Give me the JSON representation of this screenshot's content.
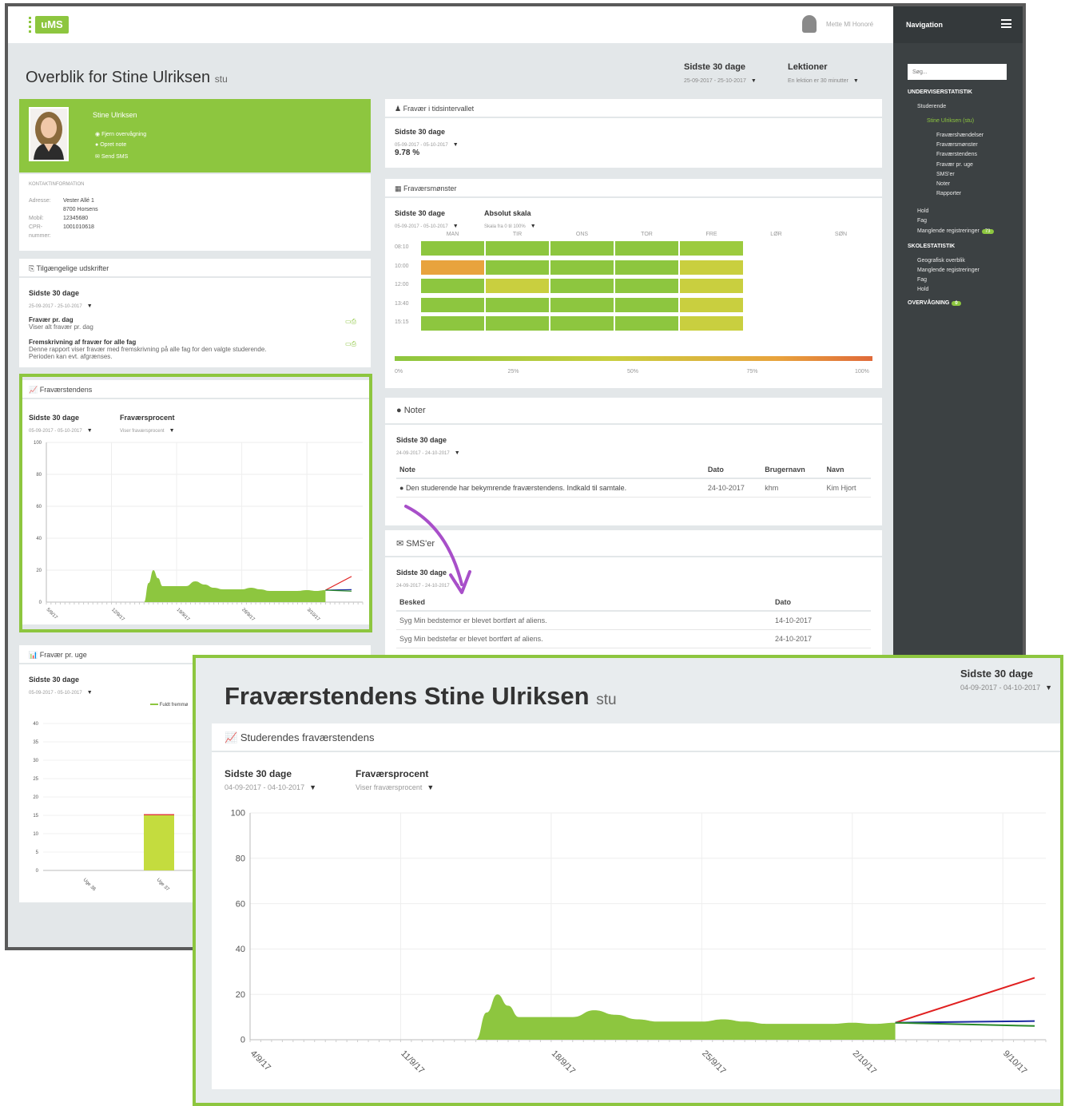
{
  "topbar": {
    "logo": "uMS",
    "user": "Mette Ml Honoré"
  },
  "sidebar": {
    "title": "Navigation",
    "search_placeholder": "Søg...",
    "items": [
      {
        "label": "UNDERVISERSTATISTIK",
        "kind": "section"
      },
      {
        "label": "Studerende",
        "kind": "item"
      },
      {
        "label": "Stine Ulriksen (stu)",
        "kind": "active"
      },
      {
        "label": "Fraværshændelser",
        "kind": "sub"
      },
      {
        "label": "Fraværsmønster",
        "kind": "sub"
      },
      {
        "label": "Fraværstendens",
        "kind": "sub"
      },
      {
        "label": "Fravær pr. uge",
        "kind": "sub"
      },
      {
        "label": "SMS'er",
        "kind": "sub"
      },
      {
        "label": "Noter",
        "kind": "sub"
      },
      {
        "label": "Rapporter",
        "kind": "sub"
      },
      {
        "label": "Hold",
        "kind": "item"
      },
      {
        "label": "Fag",
        "kind": "item"
      },
      {
        "label": "Manglende registreringer",
        "kind": "item",
        "badge": "73"
      },
      {
        "label": "SKOLESTATISTIK",
        "kind": "section"
      },
      {
        "label": "Geografisk overblik",
        "kind": "item"
      },
      {
        "label": "Manglende registreringer",
        "kind": "item"
      },
      {
        "label": "Fag",
        "kind": "item"
      },
      {
        "label": "Hold",
        "kind": "item"
      },
      {
        "label": "OVERVÅGNING",
        "kind": "section",
        "badge": "0"
      }
    ]
  },
  "page": {
    "title": "Overblik for Stine Ulriksen",
    "tag": "stu",
    "filter_period": {
      "label": "Sidste 30 dage",
      "range": "25-09-2017 - 25-10-2017"
    },
    "filter_lessons": {
      "label": "Lektioner",
      "sub": "En lektion er 30 minutter"
    }
  },
  "profile": {
    "name": "Stine Ulriksen",
    "links": [
      "Fjern overvågning",
      "Opret note",
      "Send SMS"
    ],
    "contact_title": "KONTAKTINFORMATION",
    "contact": [
      {
        "k": "Adresse:",
        "v": "Vester Allé 1"
      },
      {
        "k": "",
        "v": "8700 Horsens"
      },
      {
        "k": "Mobil:",
        "v": "12345680"
      },
      {
        "k": "CPR-",
        "v": "1001010618"
      },
      {
        "k": "nummer:",
        "v": ""
      }
    ]
  },
  "reports": {
    "title": "Tilgængelige udskrifter",
    "period": "Sidste 30 dage",
    "range": "25-09-2017 - 25-10-2017",
    "items": [
      {
        "title": "Fravær pr. dag",
        "desc": "Viser alt fravær pr. dag"
      },
      {
        "title": "Fremskrivning af fravær for alle fag",
        "desc": "Denne rapport viser fravær med fremskrivning på alle fag for den valgte studerende.",
        "desc2": "Perioden kan evt. afgrænses."
      }
    ]
  },
  "trend_small": {
    "title": "Fraværstendens",
    "period": "Sidste 30 dage",
    "range": "05-09-2017 - 05-10-2017",
    "metric": "Fraværsprocent",
    "metric_sub": "Viser fraværsprocent",
    "yticks": [
      "100",
      "80",
      "60",
      "40",
      "20",
      "0"
    ],
    "xticks": [
      "5/9/17",
      "12/9/17",
      "19/9/17",
      "26/9/17",
      "3/10/17"
    ]
  },
  "weekly": {
    "title": "Fravær pr. uge",
    "period": "Sidste 30 dage",
    "range": "05-09-2017 - 05-10-2017",
    "legend": "Fuldt fremmø",
    "yticks": [
      "40",
      "35",
      "30",
      "25",
      "20",
      "15",
      "10",
      "5",
      "0"
    ],
    "xticks": [
      "Uge 36",
      "Uge 37"
    ]
  },
  "absence": {
    "title": "Fravær i tidsintervallet",
    "period": "Sidste 30 dage",
    "range": "05-09-2017 - 05-10-2017",
    "value": "9.78 %"
  },
  "pattern": {
    "title": "Fraværsmønster",
    "period": "Sidste 30 dage",
    "range": "05-09-2017 - 05-10-2017",
    "scale": "Absolut skala",
    "scale_sub": "Skala fra 0 til 100%",
    "days": [
      "MAN",
      "TIR",
      "ONS",
      "TOR",
      "FRE",
      "LØR",
      "SØN"
    ],
    "times": [
      "08:10",
      "10:00",
      "12:00",
      "13:40",
      "15:15"
    ],
    "colors": [
      [
        "#8dc63f",
        "#8dc63f",
        "#8dc63f",
        "#8dc63f",
        "#9ccb3e"
      ],
      [
        "#e8a33d",
        "#8dc63f",
        "#8dc63f",
        "#8dc63f",
        "#c9cf3f"
      ],
      [
        "#8dc63f",
        "#c9cf3f",
        "#8dc63f",
        "#8dc63f",
        "#c9cf3f"
      ],
      [
        "#8dc63f",
        "#8dc63f",
        "#8dc63f",
        "#8dc63f",
        "#c9cf3f"
      ],
      [
        "#8dc63f",
        "#8dc63f",
        "#8dc63f",
        "#8dc63f",
        "#c9cf3f"
      ]
    ],
    "scale_ticks": [
      "0%",
      "25%",
      "50%",
      "75%",
      "100%"
    ]
  },
  "notes": {
    "title": "Noter",
    "period": "Sidste 30 dage",
    "range": "24-09-2017 - 24-10-2017",
    "headers": [
      "Note",
      "Dato",
      "Brugernavn",
      "Navn"
    ],
    "rows": [
      [
        "Den studerende har bekymrende fraværstendens. Indkald til samtale.",
        "24-10-2017",
        "khm",
        "Kim Hjort"
      ]
    ]
  },
  "sms": {
    "title": "SMS'er",
    "period": "Sidste 30 dage",
    "range": "24-09-2017 - 24-10-2017",
    "headers": [
      "Besked",
      "Dato"
    ],
    "rows": [
      [
        "Syg Min bedstemor er blevet bortført af aliens.",
        "14-10-2017"
      ],
      [
        "Syg Min bedstefar er blevet bortført af aliens.",
        "24-10-2017"
      ]
    ]
  },
  "zoom": {
    "title": "Fraværstendens Stine Ulriksen",
    "tag": "stu",
    "filter_label": "Sidste 30 dage",
    "filter_range": "04-09-2017 - 04-10-2017",
    "card_title": "Studerendes fraværstendens",
    "period": "Sidste 30 dage",
    "range": "04-09-2017 - 04-10-2017",
    "metric": "Fraværsprocent",
    "metric_sub": "Viser fraværsprocent"
  },
  "colors": {
    "accent": "#8dc63f",
    "sidebar": "#3c4143",
    "arrow": "#a84fc9",
    "projection_high": "#e02020",
    "projection_mid": "#1a2aa0",
    "projection_low": "#2a8a2a"
  },
  "chart_data": {
    "type": "area",
    "yticks": [
      0,
      20,
      40,
      60,
      80,
      100
    ],
    "ylim": [
      0,
      100
    ],
    "xticks": [
      "4/9/17",
      "11/9/17",
      "18/9/17",
      "25/9/17",
      "2/10/17",
      "9/10/17"
    ],
    "xrange_days": [
      0,
      36
    ],
    "series": [
      {
        "values_x": [
          10.5,
          11.0,
          11.5,
          12.0,
          12.5,
          13.0,
          14.0,
          15.0,
          16.0,
          17.0,
          18.0,
          19.0,
          20.0,
          21.0,
          22.0,
          23.0,
          24.0,
          25.0,
          26.0,
          27.0,
          28.0,
          29.0,
          30.0
        ],
        "values_y": [
          0,
          12,
          20,
          15,
          10,
          10,
          10,
          10,
          13,
          11,
          9,
          8,
          8,
          8,
          9,
          8,
          7,
          7,
          7,
          7,
          7.5,
          7,
          7.5
        ]
      },
      {
        "values_x": [
          30,
          39
        ],
        "values_y": [
          7.5,
          35
        ]
      },
      {
        "values_x": [
          30,
          39
        ],
        "values_y": [
          7.5,
          8.5
        ]
      },
      {
        "values_x": [
          30,
          39
        ],
        "values_y": [
          7.5,
          5.5
        ]
      }
    ]
  }
}
